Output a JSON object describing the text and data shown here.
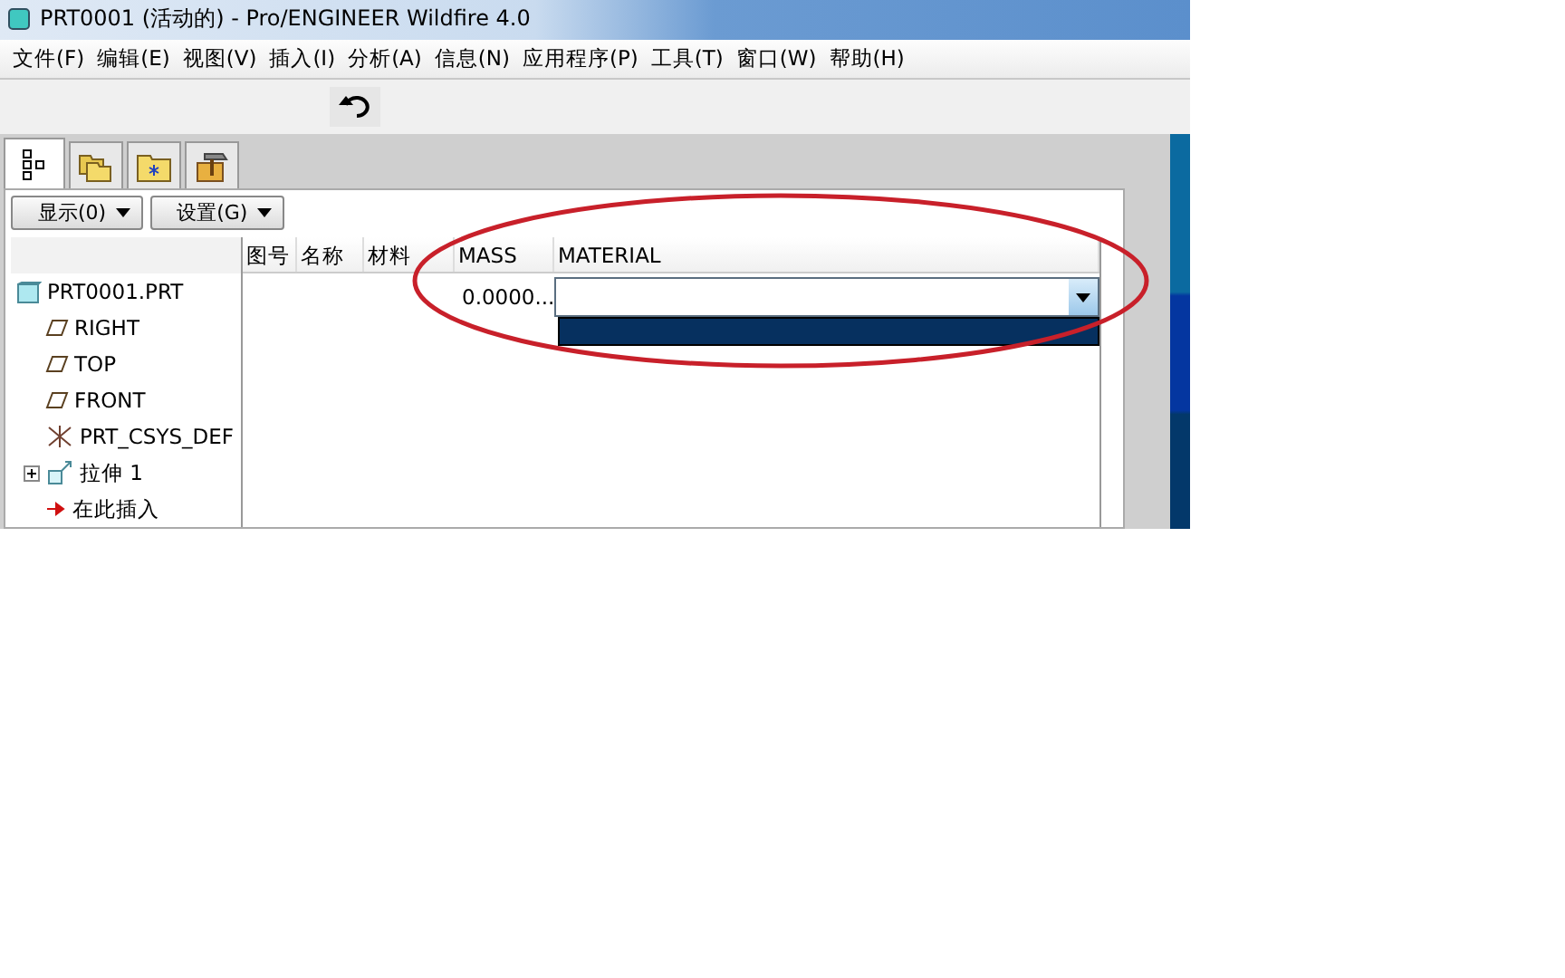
{
  "window": {
    "title": "PRT0001 (活动的) - Pro/ENGINEER Wildfire 4.0"
  },
  "menu": [
    "文件(F)",
    "编辑(E)",
    "视图(V)",
    "插入(I)",
    "分析(A)",
    "信息(N)",
    "应用程序(P)",
    "工具(T)",
    "窗口(W)",
    "帮助(H)"
  ],
  "navigator_tabs": [
    {
      "kind": "tree",
      "selected": true
    },
    {
      "kind": "folders",
      "selected": false
    },
    {
      "kind": "favorites",
      "selected": false
    },
    {
      "kind": "tools",
      "selected": false
    }
  ],
  "panel_buttons": [
    "显示(0)",
    "设置(G)"
  ],
  "tree": [
    {
      "label": "PRT0001.PRT",
      "kind": "part",
      "children": [
        {
          "label": "RIGHT",
          "kind": "plane"
        },
        {
          "label": "TOP",
          "kind": "plane"
        },
        {
          "label": "FRONT",
          "kind": "plane"
        },
        {
          "label": "PRT_CSYS_DEF",
          "kind": "csys"
        },
        {
          "label": "拉伸 1",
          "kind": "extrude",
          "expanded": false
        },
        {
          "label": "在此插入",
          "kind": "insert"
        }
      ]
    }
  ],
  "table": {
    "columns": [
      "图号",
      "名称",
      "材料",
      "MASS",
      "MATERIAL"
    ],
    "rows": [
      {
        "cells": [
          "",
          "",
          "",
          "0.0000...",
          ""
        ],
        "dropdown_open": true
      }
    ]
  }
}
